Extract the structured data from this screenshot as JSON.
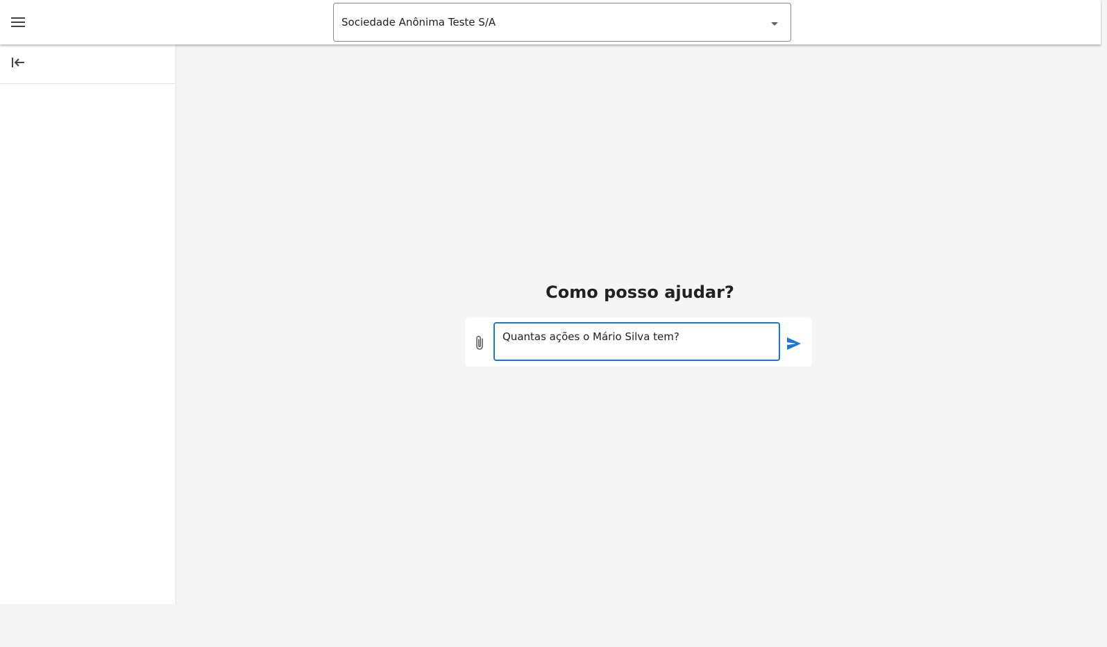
{
  "header": {
    "menu_icon": "menu-icon",
    "company_select": {
      "selected": "Sociedade Anônima Teste S/A",
      "arrow_icon": "caret-down-icon"
    }
  },
  "sidebar": {
    "collapse_icon": "collapse-left-icon"
  },
  "main": {
    "title": "Como posso ajudar?",
    "chat": {
      "attach_icon": "paperclip-icon",
      "input_value": "Quantas ações o Mário Silva tem?",
      "send_icon": "send-icon"
    }
  },
  "colors": {
    "accent": "#1976d2",
    "background": "#f5f5f5",
    "surface": "#ffffff"
  }
}
